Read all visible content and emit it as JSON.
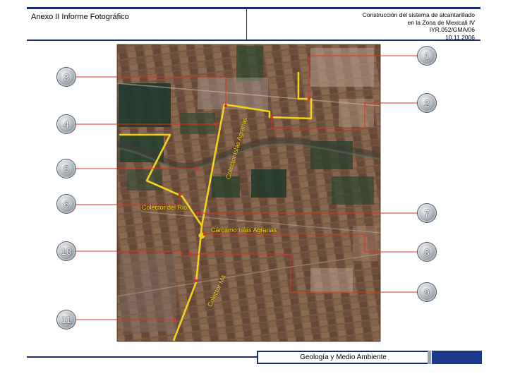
{
  "header": {
    "title": "Anexo II Informe Fotográfico",
    "project_lines": [
      "Construcción del sistema de alcantarillado",
      "en la Zona de Mexicali IV",
      "IYR.052/GMA/06",
      "10.11.2006"
    ]
  },
  "map": {
    "labels": {
      "colector_islas_agrarias": "Colector  Islas Agrarias",
      "colector_del_rio": "Colector del Rio",
      "carcamo": "Cárcamo Islas Agrarias",
      "colector_m4": "Colector  M4"
    },
    "markers": [
      "1",
      "2",
      "3",
      "4",
      "5",
      "6",
      "7",
      "8",
      "9",
      "10",
      "11"
    ],
    "colors": {
      "pipeline": "#f2d21a",
      "leader_line": "#e0301e",
      "header_rule": "#1a2c6b"
    }
  },
  "footer": {
    "section": "Geología y Medio Ambiente"
  }
}
